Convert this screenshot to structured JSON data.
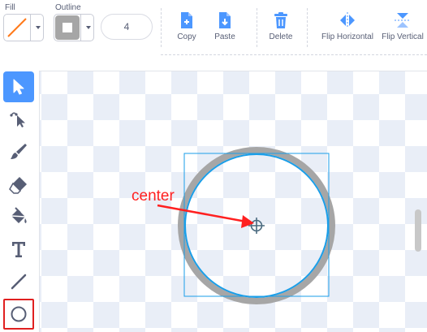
{
  "toolbar": {
    "fill_label": "Fill",
    "outline_label": "Outline",
    "outline_width": "4",
    "copy_label": "Copy",
    "paste_label": "Paste",
    "delete_label": "Delete",
    "flip_horizontal_label": "Flip Horizontal",
    "flip_vertical_label": "Flip Vertical"
  },
  "tools": [
    {
      "name": "select",
      "icon": "arrow-cursor-icon",
      "active": true
    },
    {
      "name": "reshape",
      "icon": "reshape-cursor-icon"
    },
    {
      "name": "brush",
      "icon": "brush-icon"
    },
    {
      "name": "eraser",
      "icon": "eraser-icon"
    },
    {
      "name": "fill",
      "icon": "paint-bucket-icon"
    },
    {
      "name": "text",
      "icon": "text-icon"
    },
    {
      "name": "line",
      "icon": "line-icon"
    },
    {
      "name": "circle",
      "icon": "circle-icon",
      "highlighted": true
    }
  ],
  "canvas": {
    "annotation_text": "center"
  },
  "colors": {
    "accent": "#4c97ff",
    "selection": "#1a9ee8",
    "annotation": "#ff2020",
    "outline_gray": "#a6a6a6",
    "fill_swatch_line": "#ff7a1a"
  }
}
